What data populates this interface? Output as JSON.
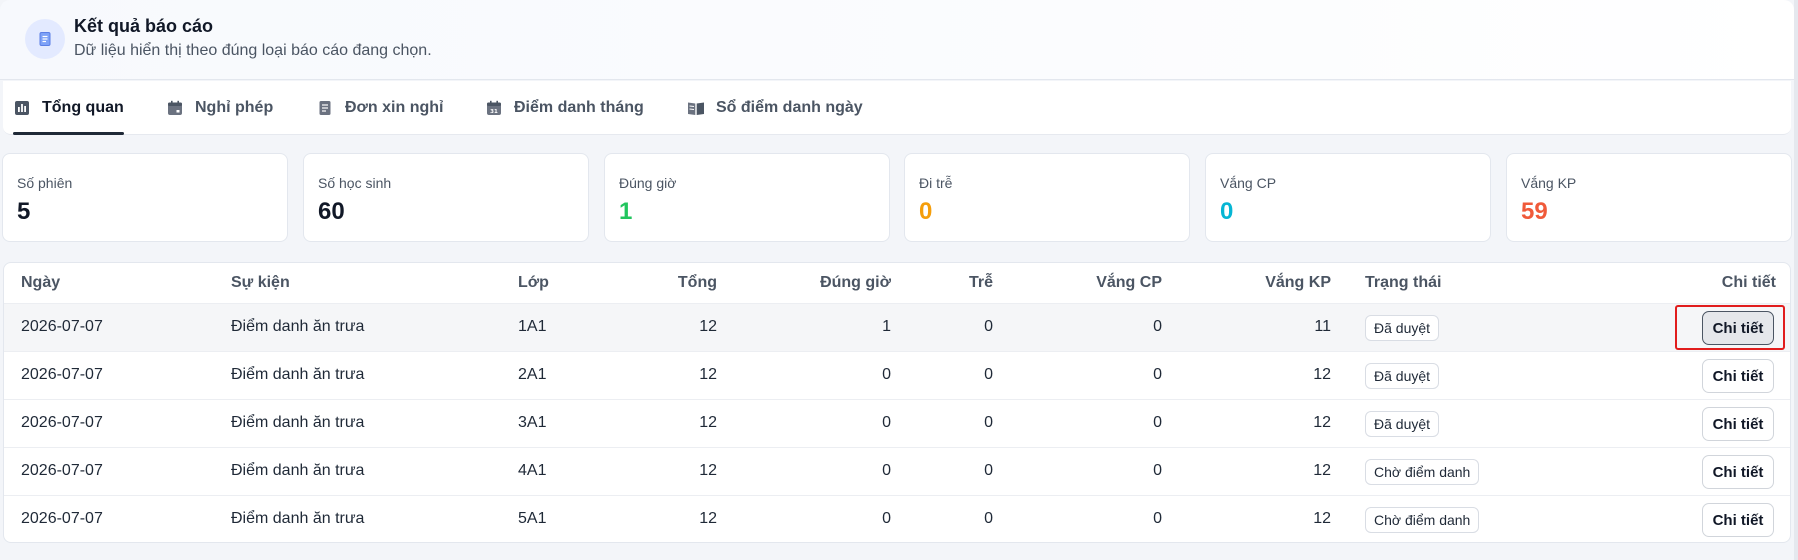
{
  "header": {
    "title": "Kết quả báo cáo",
    "subtitle": "Dữ liệu hiển thị theo đúng loại báo cáo đang chọn.",
    "icon": "document-icon"
  },
  "tabs": [
    {
      "label": "Tổng quan",
      "icon": "bar-chart-icon",
      "active": true
    },
    {
      "label": "Nghỉ phép",
      "icon": "calendar-icon",
      "active": false
    },
    {
      "label": "Đơn xin nghỉ",
      "icon": "document-icon",
      "active": false
    },
    {
      "label": "Điểm danh tháng",
      "icon": "calendar-month-icon",
      "active": false
    },
    {
      "label": "Sổ điểm danh ngày",
      "icon": "book-icon",
      "active": false
    }
  ],
  "stats": [
    {
      "label": "Số phiên",
      "value": "5",
      "color": "#111827"
    },
    {
      "label": "Số học sinh",
      "value": "60",
      "color": "#111827"
    },
    {
      "label": "Đúng giờ",
      "value": "1",
      "color": "#22c55e"
    },
    {
      "label": "Đi trễ",
      "value": "0",
      "color": "#f59e0b"
    },
    {
      "label": "Vắng CP",
      "value": "0",
      "color": "#06b6d4"
    },
    {
      "label": "Vắng KP",
      "value": "59",
      "color": "#f05a3a"
    }
  ],
  "table": {
    "columns": [
      "Ngày",
      "Sự kiện",
      "Lớp",
      "Tổng",
      "Đúng giờ",
      "Trễ",
      "Vắng CP",
      "Vắng KP",
      "Trạng thái",
      "Chi tiết"
    ],
    "rows": [
      {
        "date": "2026-07-07",
        "event": "Điểm danh ăn trưa",
        "class": "1A1",
        "total": "12",
        "ontime": "1",
        "late": "0",
        "absent_excused": "0",
        "absent_unexcused": "11",
        "status": "Đã duyệt",
        "action": "Chi tiết"
      },
      {
        "date": "2026-07-07",
        "event": "Điểm danh ăn trưa",
        "class": "2A1",
        "total": "12",
        "ontime": "0",
        "late": "0",
        "absent_excused": "0",
        "absent_unexcused": "12",
        "status": "Đã duyệt",
        "action": "Chi tiết"
      },
      {
        "date": "2026-07-07",
        "event": "Điểm danh ăn trưa",
        "class": "3A1",
        "total": "12",
        "ontime": "0",
        "late": "0",
        "absent_excused": "0",
        "absent_unexcused": "12",
        "status": "Đã duyệt",
        "action": "Chi tiết"
      },
      {
        "date": "2026-07-07",
        "event": "Điểm danh ăn trưa",
        "class": "4A1",
        "total": "12",
        "ontime": "0",
        "late": "0",
        "absent_excused": "0",
        "absent_unexcused": "12",
        "status": "Chờ điểm danh",
        "action": "Chi tiết"
      },
      {
        "date": "2026-07-07",
        "event": "Điểm danh ăn trưa",
        "class": "5A1",
        "total": "12",
        "ontime": "0",
        "late": "0",
        "absent_excused": "0",
        "absent_unexcused": "12",
        "status": "Chờ điểm danh",
        "action": "Chi tiết"
      }
    ]
  }
}
